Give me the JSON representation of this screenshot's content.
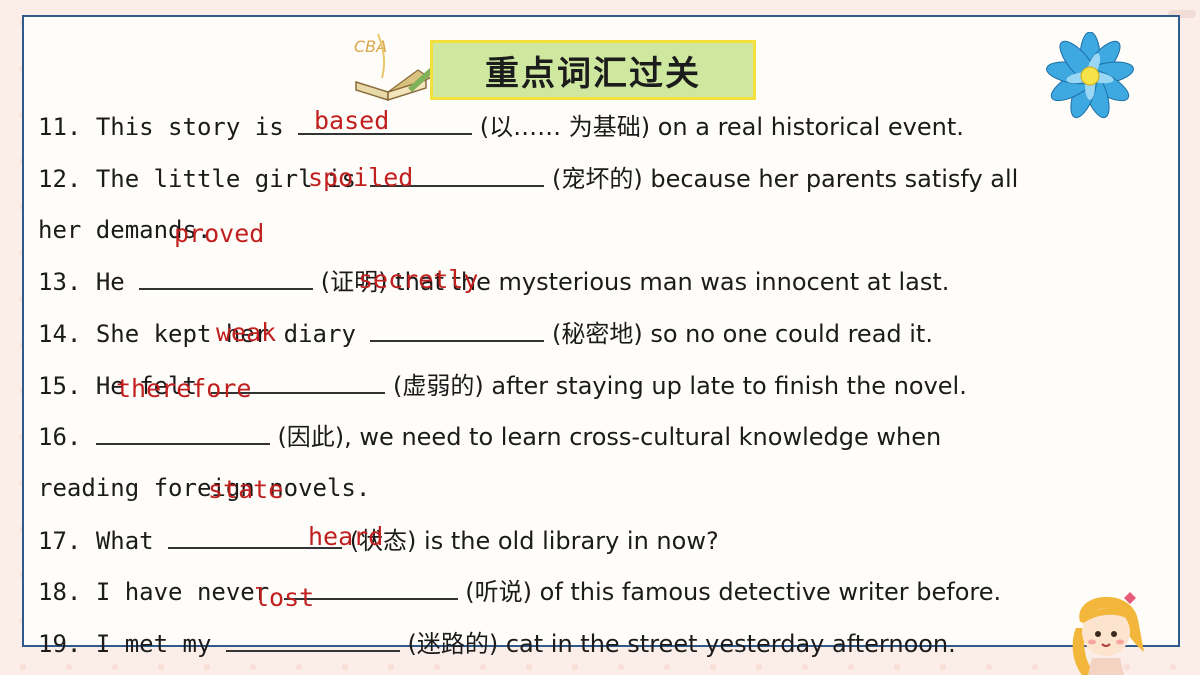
{
  "header": {
    "title": "重点词汇过关"
  },
  "decorations": {
    "book_icon_text": "CBA"
  },
  "exercises": [
    {
      "num": "11.",
      "before": "This story is ",
      "after": " (以…… 为基础) on a real historical event."
    },
    {
      "num": "12.",
      "before": "The little girl is ",
      "after": " (宠坏的) because her parents satisfy all"
    },
    {
      "cont": "her demands."
    },
    {
      "num": "13.",
      "before": "He ",
      "after": " (证明) that the mysterious man was innocent at last."
    },
    {
      "num": "14.",
      "before": "She kept her diary ",
      "after": " (秘密地) so no one could read it."
    },
    {
      "num": "15.",
      "before": "He felt ",
      "after": " (虚弱的) after staying up late to finish the novel."
    },
    {
      "num": "16.",
      "before": "",
      "after": " (因此), we need to learn cross-cultural knowledge when"
    },
    {
      "cont": "reading foreign novels."
    },
    {
      "num": "17.",
      "before": "What ",
      "after": " (状态) is the old library in now?"
    },
    {
      "num": "18.",
      "before": "I have never ",
      "after": " (听说) of this famous detective writer before."
    },
    {
      "num": "19.",
      "before": "I met my ",
      "after": " (迷路的) cat in the street yesterday afternoon."
    }
  ],
  "answers": [
    "based",
    "spoiled",
    "proved",
    "secretly",
    "weak",
    "therefore",
    "state",
    "heard",
    "lost"
  ],
  "colors": {
    "answer": "#c0201e",
    "title_bg": "#cfe8a0",
    "title_border": "#f3e03c",
    "frame": "#2f5b8c"
  }
}
